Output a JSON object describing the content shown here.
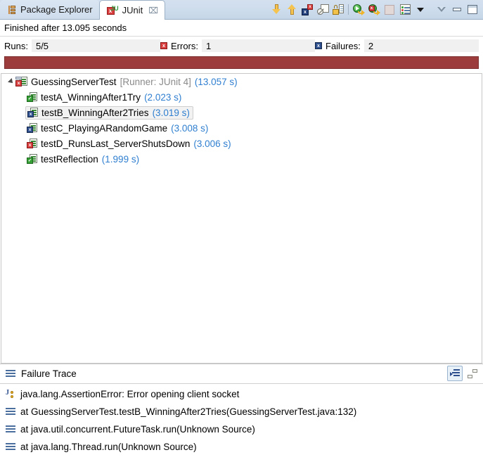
{
  "window": {
    "tabs": [
      {
        "label": "Package Explorer",
        "icon": "package-explorer-icon",
        "active": false,
        "closable": false
      },
      {
        "label": "JUnit",
        "icon": "junit-icon",
        "active": true,
        "closable": true,
        "close_glyph": "⌧"
      }
    ]
  },
  "toolbar": {
    "buttons": [
      {
        "name": "next-failed-test-button",
        "icon": "arrow-down-icon",
        "tooltip": "Next Failed Test"
      },
      {
        "name": "previous-failed-test-button",
        "icon": "arrow-up-icon",
        "tooltip": "Previous Failed Test"
      },
      {
        "name": "show-failures-only-button",
        "icon": "show-failures-only-icon",
        "tooltip": "Show Failures Only"
      },
      {
        "name": "stop-on-error-button",
        "icon": "stop-on-error-icon",
        "tooltip": "Stop on Error"
      },
      {
        "name": "lock-scrolling-button",
        "icon": "lock-icon",
        "tooltip": "Scroll Lock"
      },
      {
        "name": "rerun-test-button",
        "icon": "rerun-icon",
        "tooltip": "Rerun Test"
      },
      {
        "name": "rerun-failed-tests-button",
        "icon": "rerun-failed-icon",
        "tooltip": "Rerun Test - Failures First"
      },
      {
        "name": "stop-button",
        "icon": "stop-icon",
        "tooltip": "Stop JUnit Test Run",
        "disabled": true
      },
      {
        "name": "test-run-history-button",
        "icon": "history-icon",
        "tooltip": "Test Run History"
      },
      {
        "name": "history-dropdown-button",
        "icon": "chevron-down-icon",
        "tooltip": "Test Run History Menu"
      },
      {
        "name": "view-menu-button",
        "icon": "view-menu-icon",
        "tooltip": "View Menu"
      },
      {
        "name": "minimize-button",
        "icon": "minimize-icon",
        "tooltip": "Minimize"
      },
      {
        "name": "maximize-button",
        "icon": "maximize-icon",
        "tooltip": "Maximize"
      }
    ]
  },
  "status": {
    "text": "Finished after 13.095 seconds"
  },
  "counters": {
    "runs_label": "Runs:",
    "runs_value": "5/5",
    "errors_label": "Errors:",
    "errors_value": "1",
    "errors_icon": "error-marker-icon",
    "failures_label": "Failures:",
    "failures_value": "2",
    "failures_icon": "failure-marker-icon"
  },
  "progress": {
    "percent": 100,
    "color": "#9c3c3c",
    "state": "failed"
  },
  "tree": {
    "root": {
      "name": "GuessingServerTest",
      "runner": "[Runner: JUnit 4]",
      "time": "(13.057 s)",
      "status": "error",
      "expanded": true
    },
    "tests": [
      {
        "name": "testA_WinningAfter1Try",
        "time": "(2.023 s)",
        "status": "pass",
        "selected": false
      },
      {
        "name": "testB_WinningAfter2Tries",
        "time": "(3.019 s)",
        "status": "failure",
        "selected": true
      },
      {
        "name": "testC_PlayingARandomGame",
        "time": "(3.008 s)",
        "status": "failure",
        "selected": false
      },
      {
        "name": "testD_RunsLast_ServerShutsDown",
        "time": "(3.006 s)",
        "status": "error",
        "selected": false
      },
      {
        "name": "testReflection",
        "time": "(1.999 s)",
        "status": "pass",
        "selected": false
      }
    ]
  },
  "failure_trace": {
    "title": "Failure Trace",
    "title_icon": "stack-icon",
    "tools": [
      {
        "name": "filter-stack-trace-button",
        "icon": "filter-stack-icon",
        "pressed": true
      },
      {
        "name": "compare-result-button",
        "icon": "compare-icon",
        "pressed": false
      }
    ],
    "lines": [
      {
        "icon": "exception-icon",
        "text": "java.lang.AssertionError: Error opening client socket"
      },
      {
        "icon": "stack-frame-icon",
        "text": "at GuessingServerTest.testB_WinningAfter2Tries(GuessingServerTest.java:132)"
      },
      {
        "icon": "stack-frame-icon",
        "text": "at java.util.concurrent.FutureTask.run(Unknown Source)"
      },
      {
        "icon": "stack-frame-icon",
        "text": "at java.lang.Thread.run(Unknown Source)"
      }
    ]
  },
  "colors": {
    "progress_failed": "#9c3c3c",
    "time_text": "#2f7fd0",
    "runner_text": "#8a8a8a",
    "error_red": "#d93f3f",
    "failure_blue": "#2d4f8e",
    "pass_green": "#35a035"
  }
}
